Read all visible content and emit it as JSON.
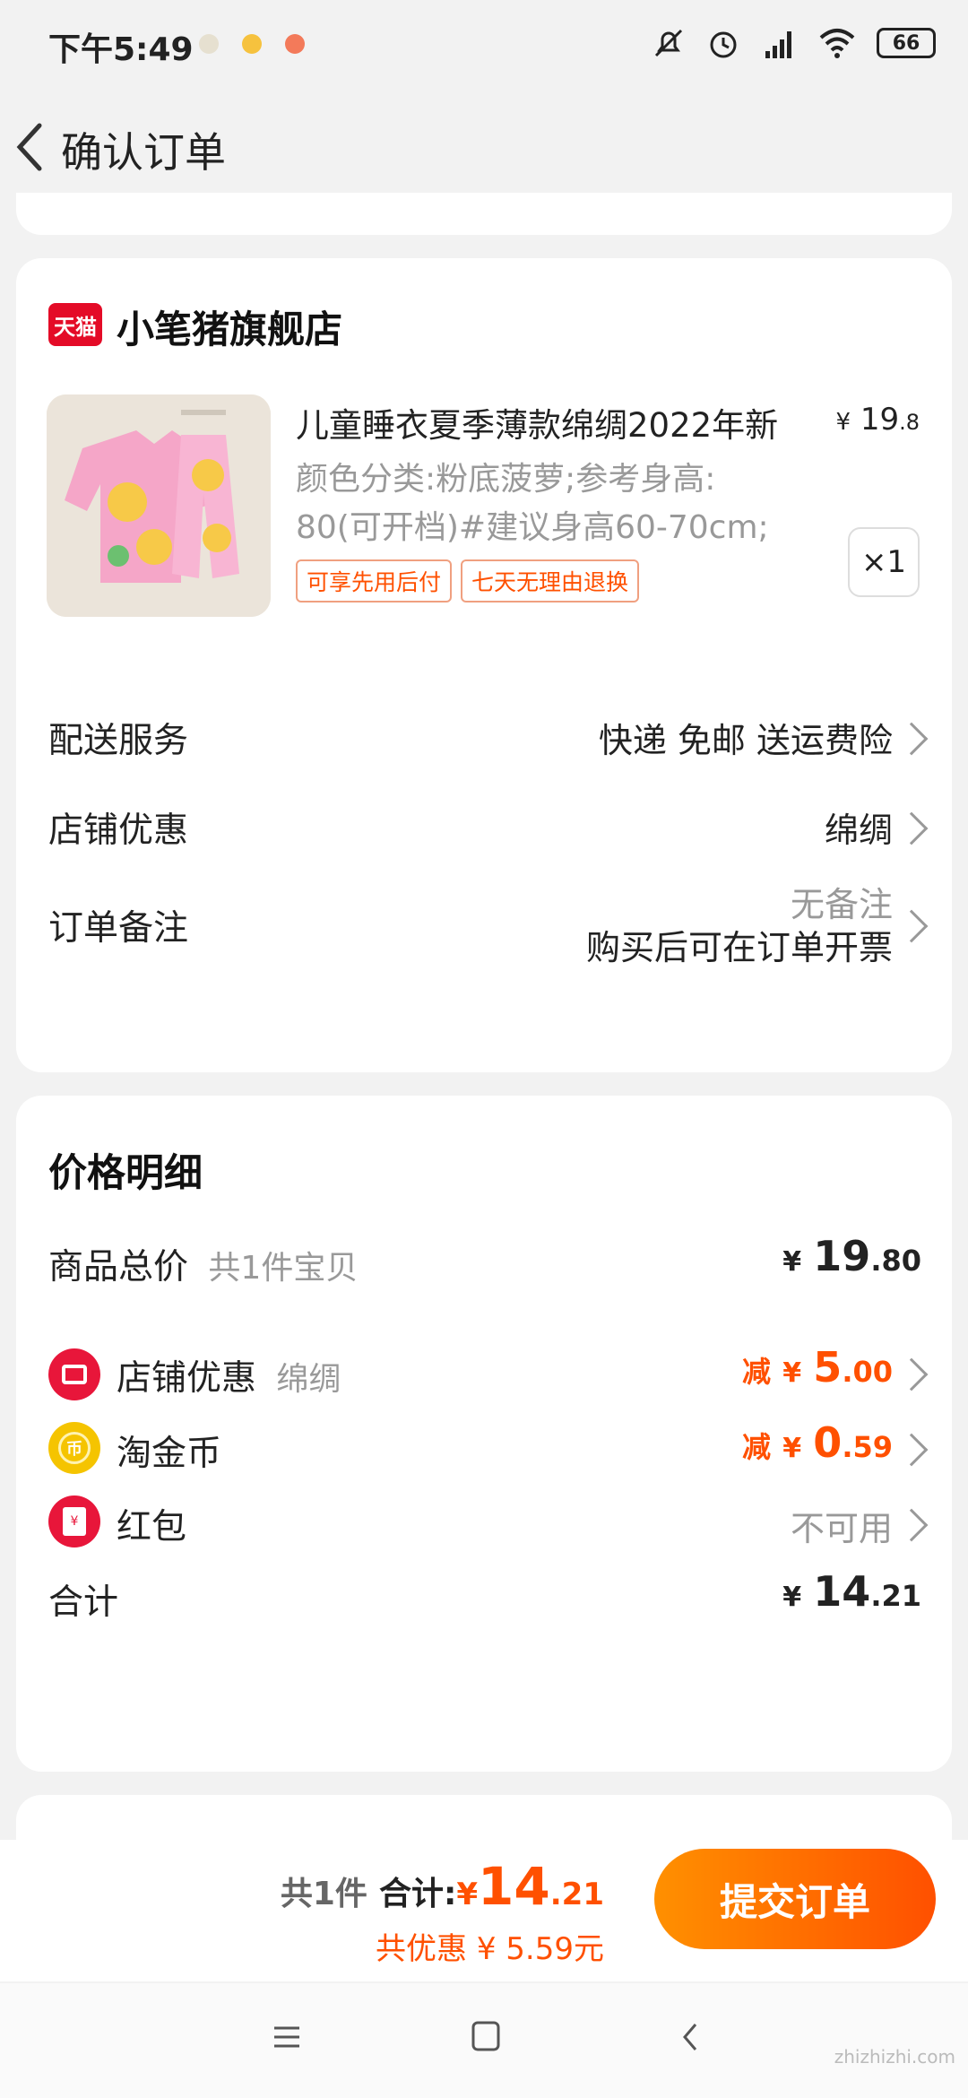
{
  "status_bar": {
    "time": "下午5:49",
    "battery": "66"
  },
  "header": {
    "title": "确认订单"
  },
  "store": {
    "badge": "天猫",
    "name": "小笔猪旗舰店",
    "product": {
      "name": "儿童睡衣夏季薄款绵绸2022年新",
      "price_currency": "¥",
      "price_int": "19",
      "price_dec": ".8",
      "spec_line1": "颜色分类:粉底菠萝;参考身高:",
      "spec_line2": "80(可开档)#建议身高60-70cm;",
      "tags": [
        "可享先用后付",
        "七天无理由退换"
      ],
      "qty": "×1"
    },
    "rows": {
      "delivery_label": "配送服务",
      "delivery_value": "快递 免邮 送运费险",
      "discount_label": "店铺优惠",
      "discount_value": "绵绸",
      "remark_label": "订单备注",
      "remark_value": "无备注",
      "remark_sub": "购买后可在订单开票"
    }
  },
  "price_detail": {
    "title": "价格明细",
    "total_label": "商品总价",
    "total_sub": "共1件宝贝",
    "total_currency": "¥",
    "total_int": "19",
    "total_dec": ".80",
    "shop_label": "店铺优惠",
    "shop_sub": "绵绸",
    "shop_prefix": "减",
    "shop_currency": "¥",
    "shop_int": "5",
    "shop_dec": ".00",
    "coin_label": "淘金币",
    "coin_prefix": "减",
    "coin_currency": "¥",
    "coin_int": "0",
    "coin_dec": ".59",
    "redpack_label": "红包",
    "redpack_value": "不可用",
    "sum_label": "合计",
    "sum_currency": "¥",
    "sum_int": "14",
    "sum_dec": ".21"
  },
  "bottom": {
    "count": "共1件",
    "total_label": "合计:",
    "currency": "¥",
    "total_int": "14",
    "total_dec": ".21",
    "saved": "共优惠 ¥ 5.59元",
    "submit": "提交订单"
  },
  "watermark": "zhizhizhi.com",
  "icons": {
    "back": "back-chevron-icon",
    "menu": "menu-icon",
    "home": "home-icon",
    "nav_back": "nav-back-icon"
  },
  "colors": {
    "accent": "#ff5000",
    "tmall_red": "#e40b27",
    "submit_start": "#ff9000"
  }
}
